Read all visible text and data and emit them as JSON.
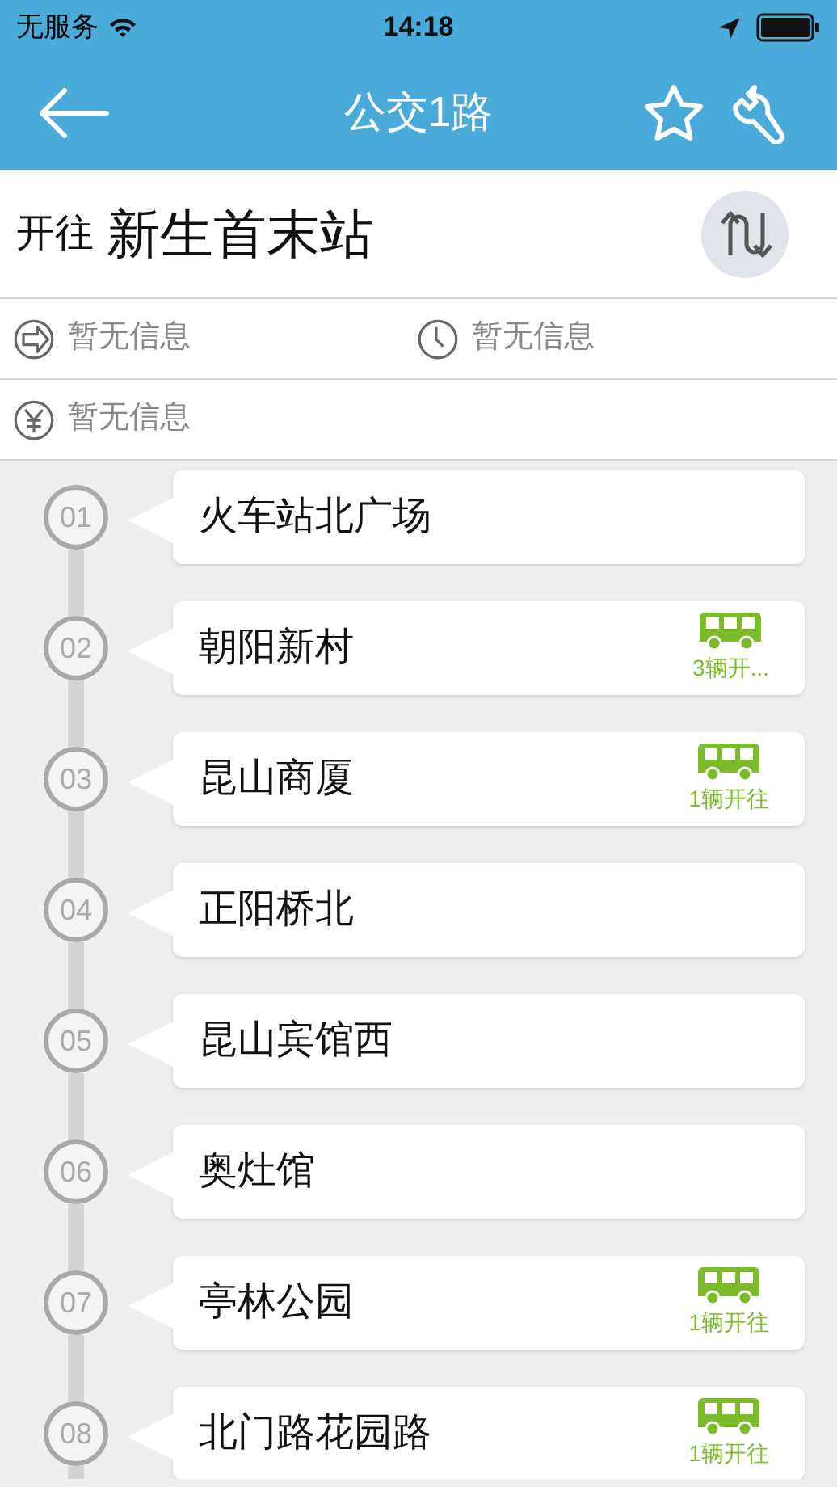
{
  "status_bar": {
    "carrier": "无服务",
    "time": "14:18"
  },
  "header": {
    "title": "公交1路"
  },
  "direction": {
    "prefix": "开往",
    "destination": "新生首末站"
  },
  "info": [
    {
      "kind": "route",
      "text": "暂无信息"
    },
    {
      "kind": "time",
      "text": "暂无信息"
    },
    {
      "kind": "fare",
      "text": "暂无信息"
    }
  ],
  "stops": [
    {
      "number": "01",
      "name": "火车站北广场"
    },
    {
      "number": "02",
      "name": "朝阳新村",
      "bus_label": "3辆开..."
    },
    {
      "number": "03",
      "name": "昆山商厦",
      "bus_label": "1辆开往"
    },
    {
      "number": "04",
      "name": "正阳桥北"
    },
    {
      "number": "05",
      "name": "昆山宾馆西"
    },
    {
      "number": "06",
      "name": "奥灶馆"
    },
    {
      "number": "07",
      "name": "亭林公园",
      "bus_label": "1辆开往"
    },
    {
      "number": "08",
      "name": "北门路花园路",
      "bus_label": "1辆开往"
    }
  ]
}
